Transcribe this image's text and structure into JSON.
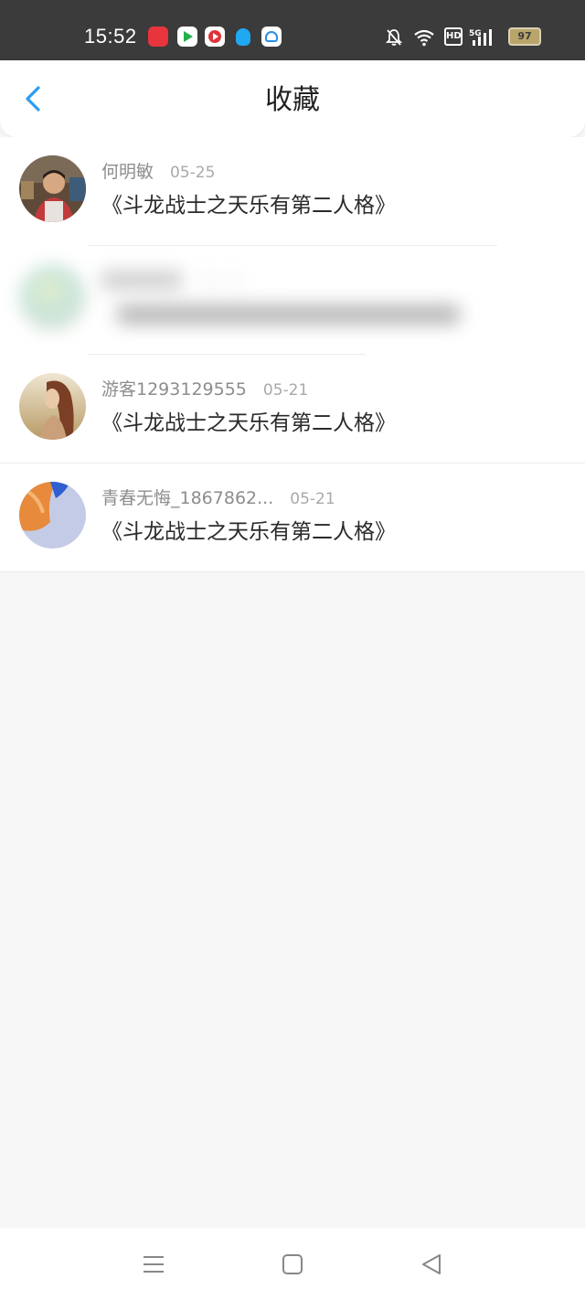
{
  "status_bar": {
    "time": "15:52",
    "battery": "97",
    "network": "5G",
    "hd_label": "HD",
    "icons": [
      "bell-mute-icon",
      "wifi-icon",
      "hd-icon",
      "signal-icon",
      "battery-icon"
    ],
    "notification_icons": [
      "xiaohongshu-icon",
      "play-store-icon",
      "video-icon",
      "qq-icon",
      "cloud-icon"
    ]
  },
  "header": {
    "title": "收藏",
    "back_icon": "chevron-left-icon"
  },
  "favorites": [
    {
      "name": "何明敏",
      "date": "05-25",
      "text": "《斗龙战士之天乐有第二人格》",
      "blurred": false
    },
    {
      "name": "██████",
      "date": "05-23",
      "text": "《████████████████████████》",
      "blurred": true
    },
    {
      "name": "游客1293129555",
      "date": "05-21",
      "text": "《斗龙战士之天乐有第二人格》",
      "blurred": false
    },
    {
      "name": "青春无悔_1867862...",
      "date": "05-21",
      "text": "《斗龙战士之天乐有第二人格》",
      "blurred": false
    }
  ],
  "nav_bar": {
    "icons": [
      "menu-icon",
      "home-icon",
      "back-triangle-icon"
    ]
  },
  "colors": {
    "accent": "#2a9df4",
    "status_bar_bg": "#3b3b3b",
    "page_bg": "#f8f7f8"
  }
}
